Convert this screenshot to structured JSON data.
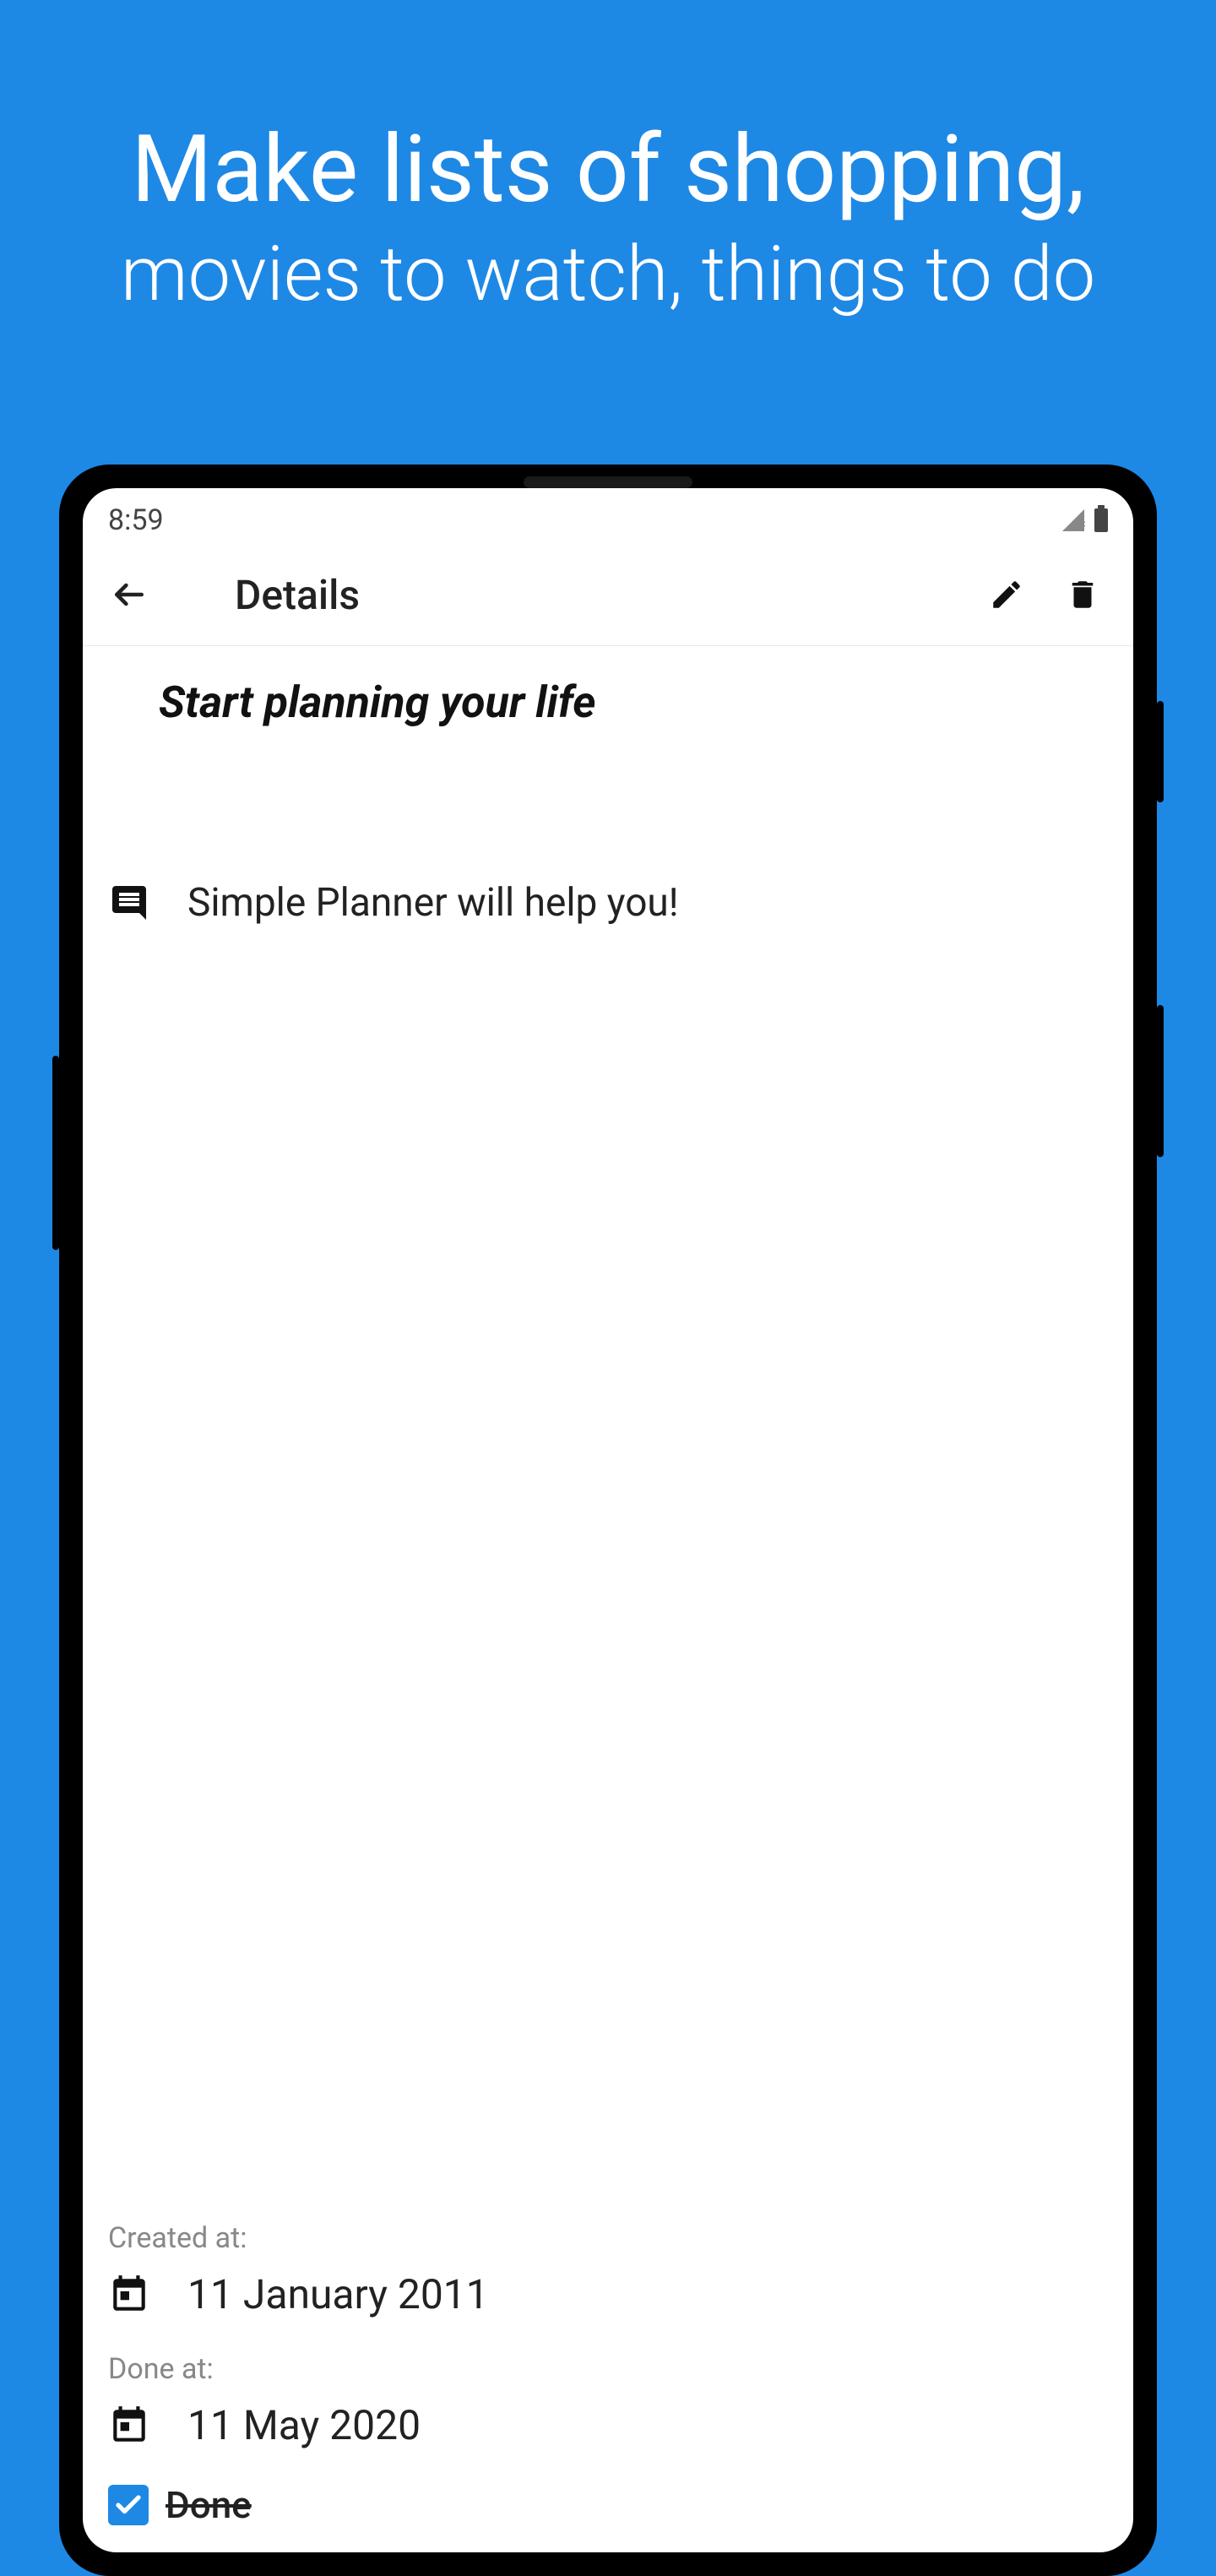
{
  "promo": {
    "line1": "Make lists of shopping,",
    "line2": "movies to watch, things to do"
  },
  "statusBar": {
    "time": "8:59"
  },
  "appBar": {
    "title": "Details"
  },
  "task": {
    "title": "Start planning your life",
    "description": "Simple Planner will help you!"
  },
  "metadata": {
    "createdAtLabel": "Created at:",
    "createdAtValue": "11 January 2011",
    "doneAtLabel": "Done at:",
    "doneAtValue": "11 May 2020",
    "doneLabel": "Done"
  }
}
